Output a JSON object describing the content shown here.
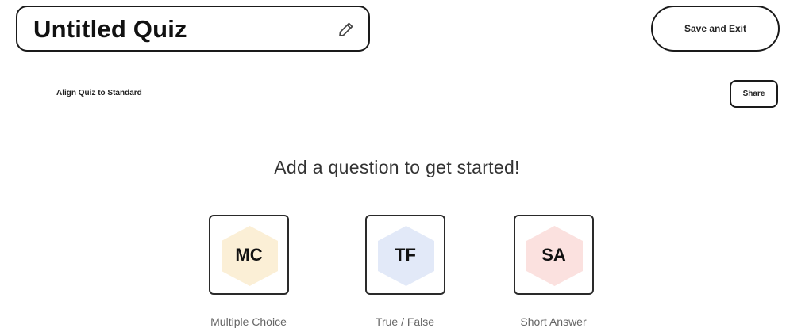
{
  "header": {
    "quiz_title": "Untitled Quiz",
    "save_label": "Save and Exit"
  },
  "toolbar": {
    "align_label": "Align Quiz to Standard",
    "share_label": "Share"
  },
  "main": {
    "prompt": "Add a question to get started!",
    "question_types": [
      {
        "abbr": "MC",
        "label": "Multiple Choice",
        "color": "#fbefd6"
      },
      {
        "abbr": "TF",
        "label": "True / False",
        "color": "#e2e9f8"
      },
      {
        "abbr": "SA",
        "label": "Short Answer",
        "color": "#fbe1df"
      }
    ]
  },
  "icons": {
    "edit": "pencil-icon"
  }
}
